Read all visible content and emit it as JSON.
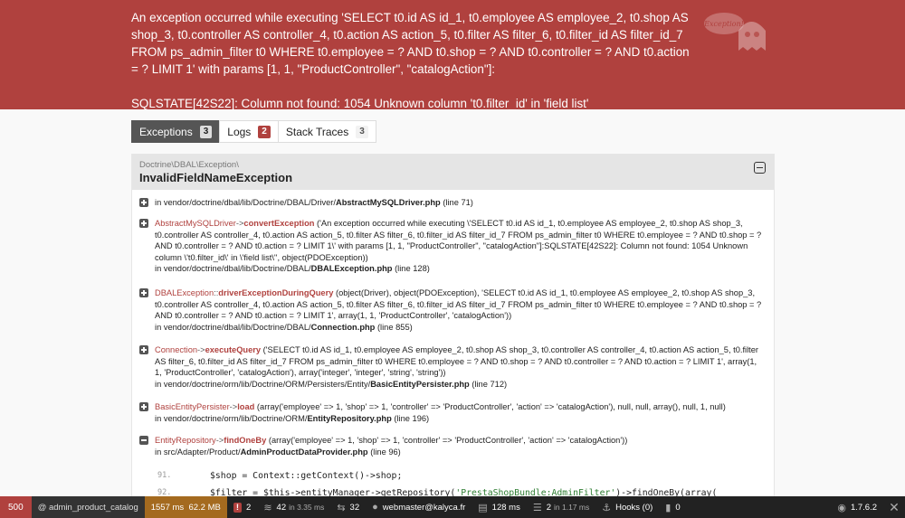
{
  "header": {
    "message": "An exception occurred while executing 'SELECT t0.id AS id_1, t0.employee AS employee_2, t0.shop AS shop_3, t0.controller AS controller_4, t0.action AS action_5, t0.filter AS filter_6, t0.filter_id AS filter_id_7 FROM ps_admin_filter t0 WHERE t0.employee = ? AND t0.shop = ? AND t0.controller = ? AND t0.action = ? LIMIT 1' with params [1, 1, \"ProductController\", \"catalogAction\"]:",
    "sqlstate": "SQLSTATE[42S22]: Column not found: 1054 Unknown column 't0.filter_id' in 'field list'",
    "ghost_text": "Exception!"
  },
  "tabs": [
    {
      "label": "Exceptions",
      "count": "3"
    },
    {
      "label": "Logs",
      "count": "2"
    },
    {
      "label": "Stack Traces",
      "count": "3"
    }
  ],
  "trace": {
    "namespace": "Doctrine\\DBAL\\Exception\\",
    "class": "InvalidFieldNameException",
    "lines": [
      {
        "prefix": "in vendor/doctrine/dbal/lib/Doctrine/DBAL/Driver/",
        "file": "AbstractMySQLDriver.php",
        "line": "(line 71)"
      },
      {
        "cls": "AbstractMySQLDriver",
        "fn": "convertException",
        "args": "('An exception occurred while executing \\'SELECT t0.id AS id_1, t0.employee AS employee_2, t0.shop AS shop_3, t0.controller AS controller_4, t0.action AS action_5, t0.filter AS filter_6, t0.filter_id AS filter_id_7 FROM ps_admin_filter t0 WHERE t0.employee = ? AND t0.shop = ? AND t0.controller = ? AND t0.action = ? LIMIT 1\\' with params [1, 1, \"ProductController\", \"catalogAction\"]:SQLSTATE[42S22]: Column not found: 1054 Unknown column \\'t0.filter_id\\' in \\'field list\\'', object(PDOException))",
        "prefix": "in vendor/doctrine/dbal/lib/Doctrine/DBAL/",
        "file": "DBALException.php",
        "line": "(line 128)"
      },
      {
        "cls": "DBALException",
        "fn": "driverExceptionDuringQuery",
        "args": "(object(Driver), object(PDOException), 'SELECT t0.id AS id_1, t0.employee AS employee_2, t0.shop AS shop_3, t0.controller AS controller_4, t0.action AS action_5, t0.filter AS filter_6, t0.filter_id AS filter_id_7 FROM ps_admin_filter t0 WHERE t0.employee = ? AND t0.shop = ? AND t0.controller = ? AND t0.action = ? LIMIT 1', array(1, 1, 'ProductController', 'catalogAction'))",
        "prefix": "in vendor/doctrine/dbal/lib/Doctrine/DBAL/",
        "file": "Connection.php",
        "line": "(line 855)"
      },
      {
        "cls": "Connection",
        "fn": "executeQuery",
        "args": "('SELECT t0.id AS id_1, t0.employee AS employee_2, t0.shop AS shop_3, t0.controller AS controller_4, t0.action AS action_5, t0.filter AS filter_6, t0.filter_id AS filter_id_7 FROM ps_admin_filter t0 WHERE t0.employee = ? AND t0.shop = ? AND t0.controller = ? AND t0.action = ? LIMIT 1', array(1, 1, 'ProductController', 'catalogAction'), array('integer', 'integer', 'string', 'string'))",
        "prefix": "in vendor/doctrine/orm/lib/Doctrine/ORM/Persisters/Entity/",
        "file": "BasicEntityPersister.php",
        "line": "(line 712)"
      },
      {
        "cls": "BasicEntityPersister",
        "fn": "load",
        "args": "(array('employee' => 1, 'shop' => 1, 'controller' => 'ProductController', 'action' => 'catalogAction'), null, null, array(), null, 1, null)",
        "prefix": "in vendor/doctrine/orm/lib/Doctrine/ORM/",
        "file": "EntityRepository.php",
        "line": "(line 196)"
      },
      {
        "cls": "EntityRepository",
        "fn": "findOneBy",
        "args": "(array('employee' => 1, 'shop' => 1, 'controller' => 'ProductController', 'action' => 'catalogAction'))",
        "prefix": "in src/Adapter/Product/",
        "file": "AdminProductDataProvider.php",
        "line": "(line 96)"
      }
    ],
    "code": [
      {
        "num": "91.",
        "src": "$shop = Context::getContext()->shop;"
      },
      {
        "num": "92.",
        "pre": "$filter = $this->entityManager->getRepository(",
        "str": "'PrestaShopBundle:AdminFilter'",
        "post": ")->findOneBy(array("
      }
    ]
  },
  "toolbar": {
    "status": "500",
    "route": "@ admin_product_catalog",
    "time": "1557 ms",
    "memory": "62.2 MB",
    "errors": "2",
    "queries": "42",
    "queries_time": "in 3.35 ms",
    "translations": "32",
    "user": "webmaster@kalyca.fr",
    "render": "128 ms",
    "cache": "2",
    "cache_time": "in 1.17 ms",
    "hooks": "Hooks (0)",
    "modules": "0",
    "version": "1.7.6.2",
    "close": "✕"
  },
  "colors": {
    "accent": "#b0413e",
    "toolbar": "#222222",
    "time": "#a46a1f"
  }
}
